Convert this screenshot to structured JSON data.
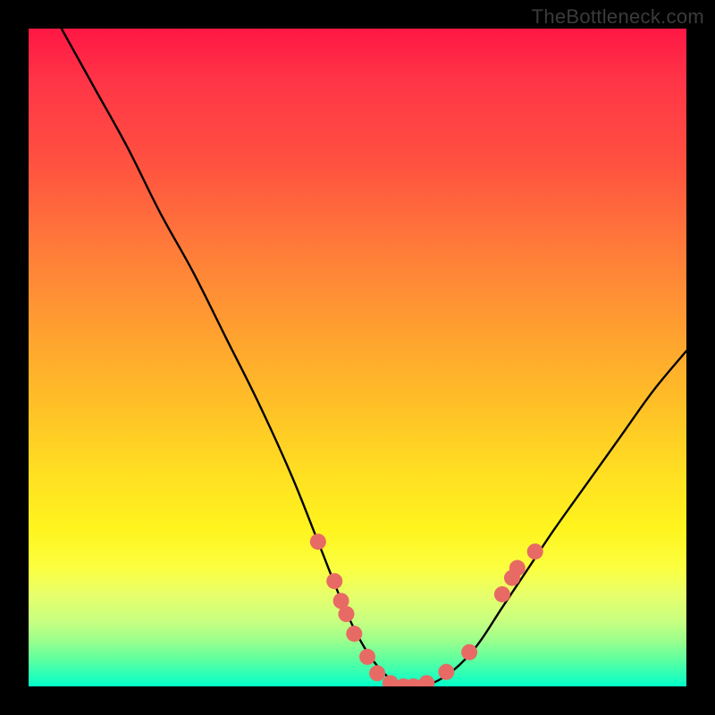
{
  "watermark": "TheBottleneck.com",
  "chart_data": {
    "type": "line",
    "title": "",
    "xlabel": "",
    "ylabel": "",
    "xlim": [
      0,
      100
    ],
    "ylim": [
      0,
      100
    ],
    "series": [
      {
        "name": "bottleneck-curve",
        "x": [
          5,
          10,
          15,
          20,
          25,
          30,
          35,
          40,
          44,
          48,
          51,
          54,
          57,
          60,
          64,
          68,
          72,
          76,
          80,
          85,
          90,
          95,
          100
        ],
        "y": [
          100,
          91,
          82,
          72,
          63,
          53,
          43,
          32,
          22,
          12,
          6,
          2,
          0,
          0,
          2,
          6,
          12,
          18,
          24,
          31,
          38,
          45,
          51
        ],
        "color": "#000000"
      }
    ],
    "markers": {
      "name": "highlight-points",
      "color": "#e86a64",
      "radius_px": 9,
      "points": [
        {
          "x": 44.0,
          "y": 22.0
        },
        {
          "x": 46.5,
          "y": 16.0
        },
        {
          "x": 47.5,
          "y": 13.0
        },
        {
          "x": 48.3,
          "y": 11.0
        },
        {
          "x": 49.5,
          "y": 8.0
        },
        {
          "x": 51.5,
          "y": 4.5
        },
        {
          "x": 53.0,
          "y": 2.0
        },
        {
          "x": 55.0,
          "y": 0.5
        },
        {
          "x": 57.0,
          "y": 0.0
        },
        {
          "x": 58.5,
          "y": 0.0
        },
        {
          "x": 60.5,
          "y": 0.5
        },
        {
          "x": 63.5,
          "y": 2.2
        },
        {
          "x": 67.0,
          "y": 5.2
        },
        {
          "x": 72.0,
          "y": 14.0
        },
        {
          "x": 73.5,
          "y": 16.5
        },
        {
          "x": 74.3,
          "y": 18.0
        },
        {
          "x": 77.0,
          "y": 20.5
        }
      ]
    }
  }
}
